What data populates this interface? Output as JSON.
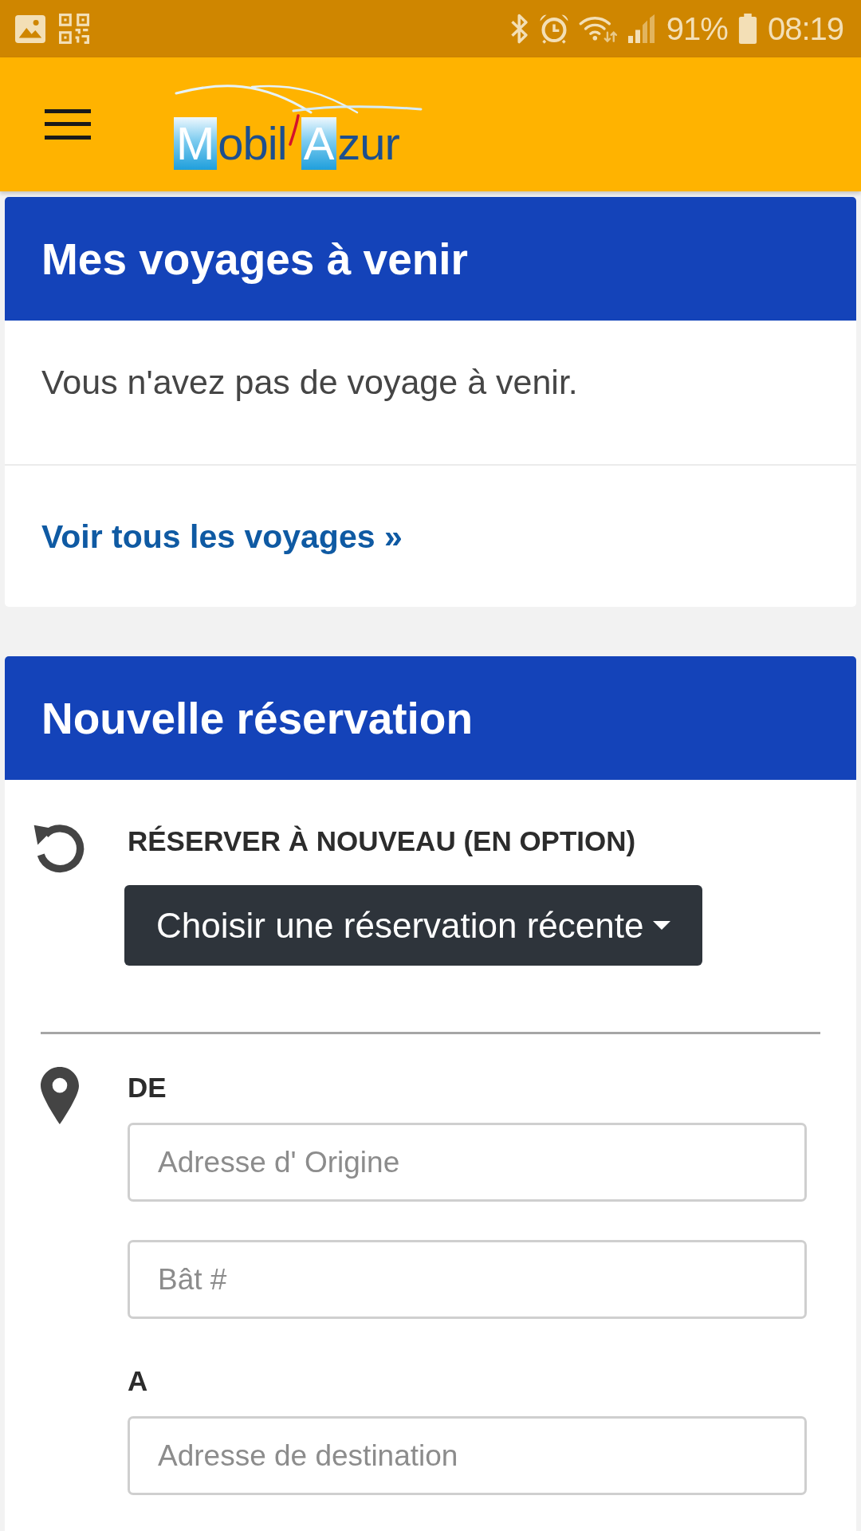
{
  "status_bar": {
    "battery": "91%",
    "time": "08:19"
  },
  "app_bar": {
    "logo": {
      "parts": [
        {
          "kind": "tile",
          "text": "M"
        },
        {
          "kind": "text",
          "text": "obil"
        },
        {
          "kind": "tile",
          "text": "A"
        },
        {
          "kind": "text",
          "text": "zur"
        }
      ]
    }
  },
  "upcoming_trips": {
    "title": "Mes voyages à venir",
    "message": "Vous n'avez pas de voyage à venir.",
    "link": "Voir tous les voyages »"
  },
  "new_booking": {
    "title": "Nouvelle réservation",
    "rebook": {
      "label": "RÉSERVER À NOUVEAU (EN OPTION)",
      "dropdown": "Choisir une réservation récente"
    },
    "locations": [
      {
        "label": "DE",
        "fields": [
          {
            "placeholder": "Adresse d' Origine"
          },
          {
            "placeholder": "Bât #"
          }
        ]
      },
      {
        "label": "A",
        "fields": [
          {
            "placeholder": "Adresse de destination"
          }
        ]
      }
    ]
  }
}
